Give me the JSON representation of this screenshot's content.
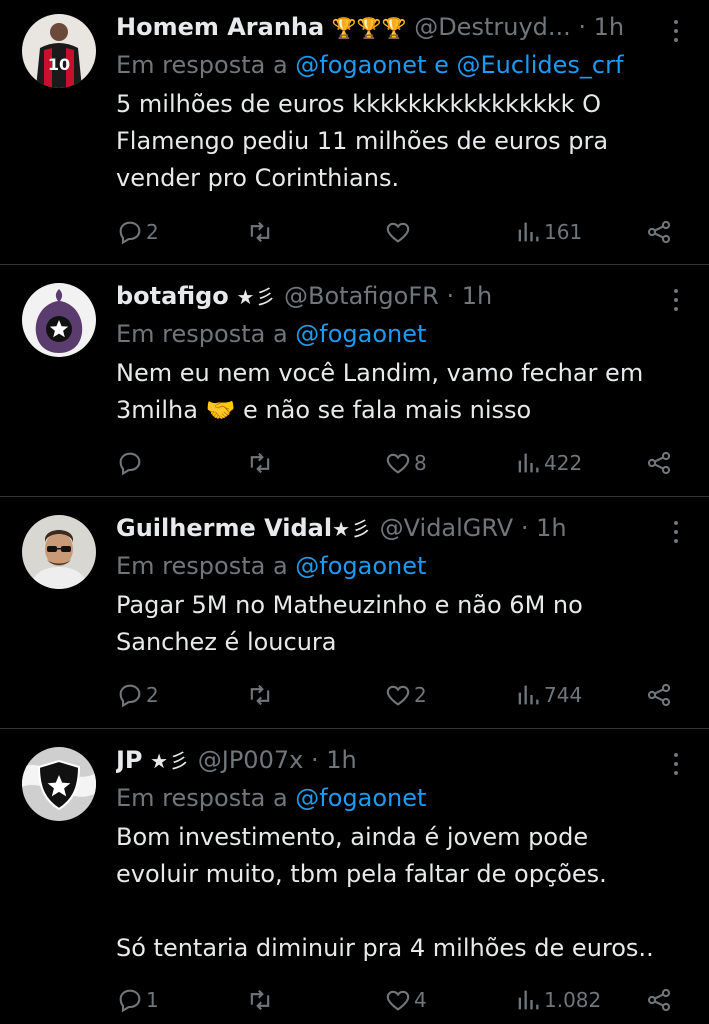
{
  "tweets": [
    {
      "name": "Homem Aranha",
      "badges": "🏆🏆🏆",
      "handle": "@Destruyd...",
      "time": "· 1h",
      "reply_prefix": "Em resposta a",
      "mentions": "@fogaonet e @Euclides_crf",
      "text_lines": [
        "5 milhões de euros kkkkkkkkkkkkkkkk O",
        "Flamengo pediu 11 milhões de euros pra",
        "vender pro Corinthians."
      ],
      "replies": "2",
      "retweets": "",
      "likes": "",
      "views": "161",
      "avatar_icon": "player-avatar"
    },
    {
      "name": "botafigo",
      "badges": "★彡",
      "handle": "@BotafigoFR",
      "time": "· 1h",
      "reply_prefix": "Em resposta a",
      "mentions": "@fogaonet",
      "text_lines": [
        "Nem eu nem você Landim, vamo fechar em",
        "3milha 🤝 e não se fala mais nisso"
      ],
      "replies": "",
      "retweets": "",
      "likes": "8",
      "views": "422",
      "avatar_icon": "fig-star-avatar"
    },
    {
      "name": "Guilherme Vidal",
      "badges": "★彡",
      "handle": "@VidalGRV",
      "time": "· 1h",
      "reply_prefix": "Em resposta a",
      "mentions": "@fogaonet",
      "text_lines": [
        "Pagar 5M no Matheuzinho e não 6M no",
        "Sanchez é loucura"
      ],
      "replies": "2",
      "retweets": "",
      "likes": "2",
      "views": "744",
      "avatar_icon": "person-sunglasses-avatar"
    },
    {
      "name": "JP",
      "badges": "★彡",
      "handle": "@JP007x",
      "time": "· 1h",
      "reply_prefix": "Em resposta a",
      "mentions": "@fogaonet",
      "text_lines": [
        "Bom investimento, ainda é jovem pode",
        "evoluir muito, tbm pela faltar de opções.",
        "",
        "Só tentaria diminuir pra 4 milhões de euros.."
      ],
      "replies": "1",
      "retweets": "",
      "likes": "4",
      "views": "1.082",
      "avatar_icon": "botafogo-crest-avatar"
    }
  ],
  "colors": {
    "background": "#000000",
    "text": "#e7e9ea",
    "muted": "#71767b",
    "link": "#1d9bf0",
    "divider": "#2f3336"
  }
}
